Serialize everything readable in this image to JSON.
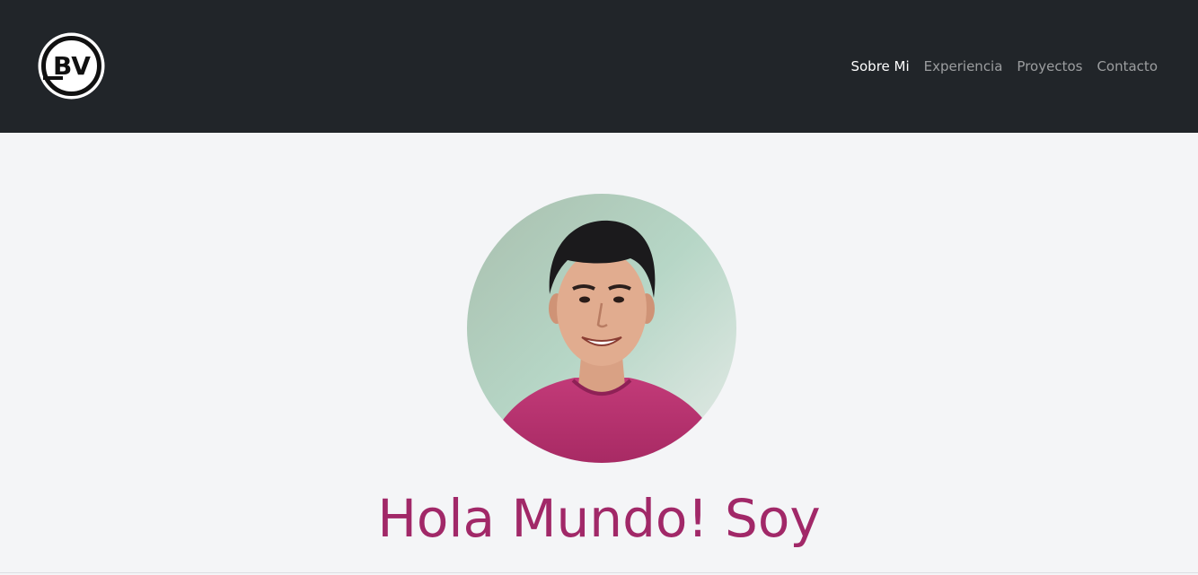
{
  "brand": {
    "logo_text": "BV"
  },
  "nav": {
    "items": [
      {
        "label": "Sobre Mi",
        "active": true
      },
      {
        "label": "Experiencia",
        "active": false
      },
      {
        "label": "Proyectos",
        "active": false
      },
      {
        "label": "Contacto",
        "active": false
      }
    ]
  },
  "hero": {
    "headline": "Hola Mundo! Soy"
  },
  "colors": {
    "navbar_bg": "#212529",
    "page_bg": "#f4f5f7",
    "accent": "#a12868",
    "shirt": "#b2336f"
  }
}
